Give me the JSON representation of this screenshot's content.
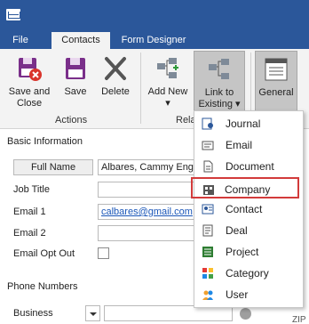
{
  "titlebar": {},
  "tabs": [
    {
      "label": "File"
    },
    {
      "label": "Contacts"
    },
    {
      "label": "Form Designer"
    }
  ],
  "ribbon": {
    "save_close": "Save and Close",
    "save": "Save",
    "delete": "Delete",
    "add_new": "Add New",
    "link_existing": "Link to Existing",
    "general": "General",
    "group_actions": "Actions",
    "group_related": "Rela"
  },
  "form": {
    "basic_info_title": "Basic Information",
    "full_name_label": "Full Name",
    "full_name_value": "Albares, Cammy Eng",
    "job_title_label": "Job Title",
    "email1_label": "Email 1",
    "email1_value": "calbares@gmail.com",
    "email2_label": "Email 2",
    "email_opt_out_label": "Email Opt Out",
    "phone_numbers_title": "Phone Numbers",
    "business_label": "Business",
    "zip_label": "ZIP"
  },
  "menu": {
    "items": [
      {
        "label": "Journal",
        "icon": "journal-icon"
      },
      {
        "label": "Email",
        "icon": "email-icon"
      },
      {
        "label": "Document",
        "icon": "document-icon"
      },
      {
        "label": "Company",
        "icon": "company-icon"
      },
      {
        "label": "Contact",
        "icon": "contact-icon"
      },
      {
        "label": "Deal",
        "icon": "deal-icon"
      },
      {
        "label": "Project",
        "icon": "project-icon"
      },
      {
        "label": "Category",
        "icon": "category-icon"
      },
      {
        "label": "User",
        "icon": "user-icon"
      }
    ],
    "highlighted": "Company"
  },
  "colors": {
    "accent": "#2b579a",
    "highlight_border": "#d23b3b",
    "link": "#1a56b8"
  }
}
